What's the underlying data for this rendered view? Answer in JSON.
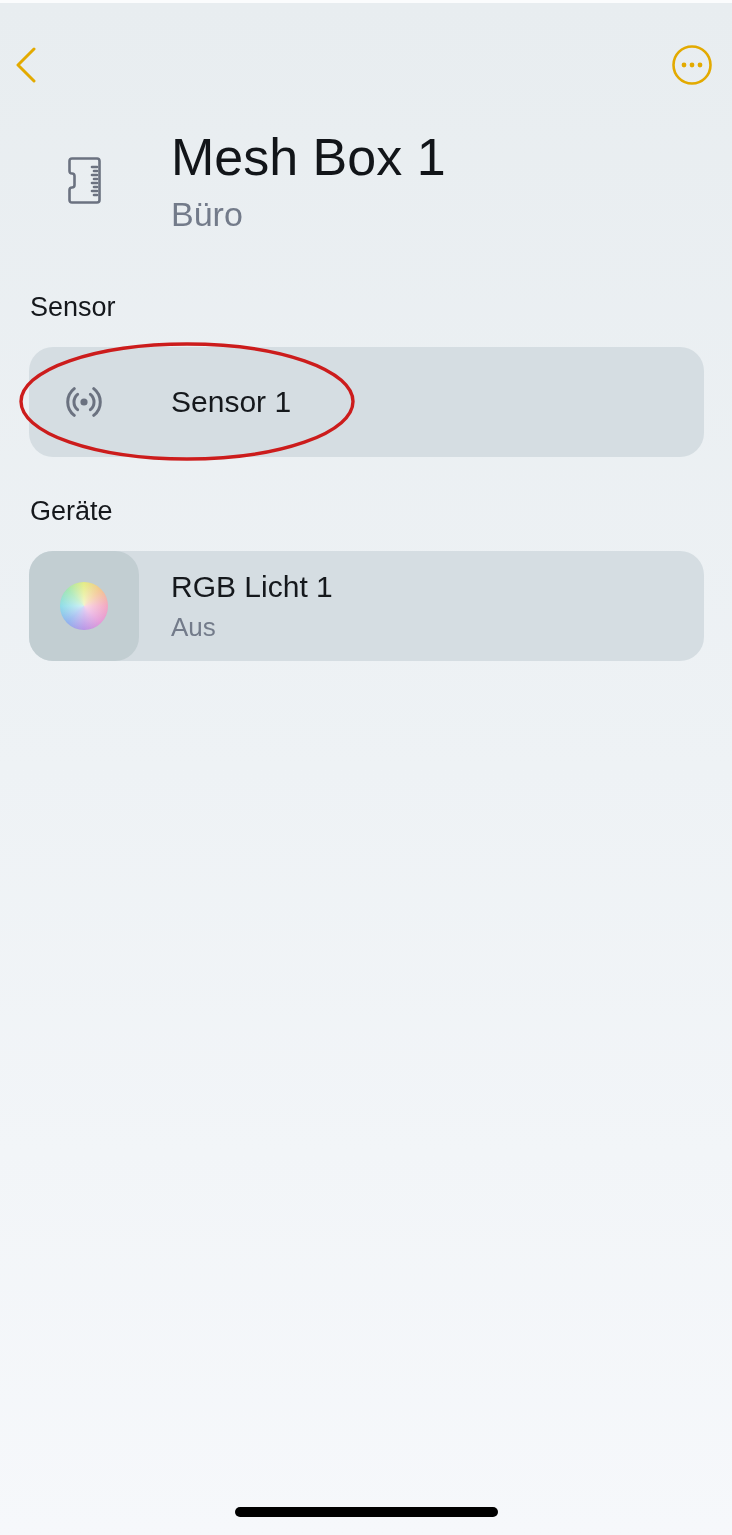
{
  "header": {
    "title": "Mesh Box 1",
    "room": "Büro"
  },
  "sections": [
    {
      "title": "Sensor",
      "items": [
        {
          "kind": "sensor",
          "name": "Sensor 1",
          "circled": true
        }
      ]
    },
    {
      "title": "Geräte",
      "items": [
        {
          "kind": "rgb-light",
          "name": "RGB Licht 1",
          "status": "Aus",
          "circled": false
        }
      ]
    }
  ]
}
